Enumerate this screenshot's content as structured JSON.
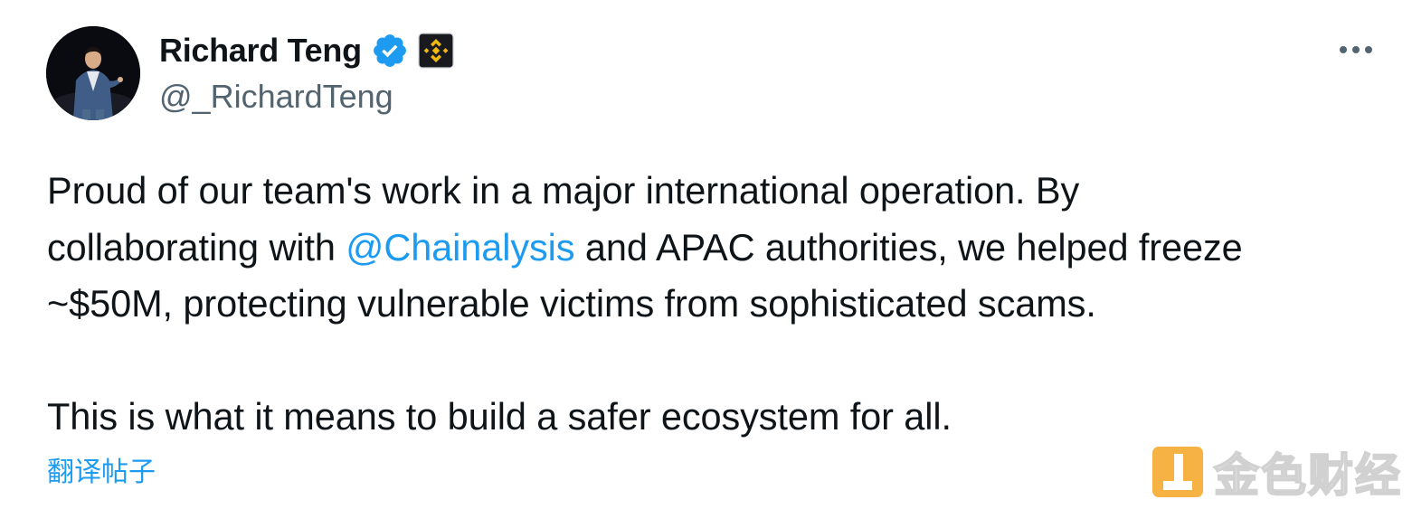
{
  "author": {
    "display_name": "Richard Teng",
    "handle": "@_RichardTeng",
    "verified": true,
    "affiliate_badge": "binance-logo-icon"
  },
  "tweet": {
    "line1": "Proud of our team's work in a major international operation. By",
    "line2_before": "collaborating with ",
    "mention": "@Chainalysis",
    "line2_after": " and APAC authorities, we helped freeze",
    "line3": "~$50M, protecting vulnerable victims from sophisticated scams.",
    "line4": "This is what it means to build a safer ecosystem for all."
  },
  "translate_label": "翻译帖子",
  "watermark": {
    "text": "金色财经"
  },
  "colors": {
    "accent": "#1d9bf0",
    "text": "#0f1419",
    "secondary": "#536471",
    "badge_gold": "#F0B90B",
    "watermark_gold": "#F5A623"
  }
}
